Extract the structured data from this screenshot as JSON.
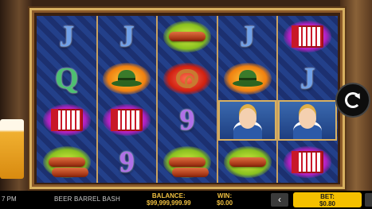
{
  "game": {
    "title": "BEER BARREL BASH"
  },
  "clock": {
    "time": "7 PM"
  },
  "reels": [
    [
      "J",
      "Q",
      "accordion",
      "sausages"
    ],
    [
      "J",
      "hat",
      "accordion",
      "9"
    ],
    [
      "sausage",
      "pretzel",
      "9",
      "sausages"
    ],
    [
      "J",
      "hat",
      "girl",
      "sausage"
    ],
    [
      "accordion",
      "J",
      "girl",
      "accordion"
    ]
  ],
  "bottom_bar": {
    "balance_label": "BALANCE:",
    "balance_value": "$99,999,999.99",
    "win_label": "WIN:",
    "win_value": "$0.00",
    "bet_label": "BET:",
    "bet_value": "$0.80",
    "bet_prev_symbol": "‹"
  },
  "colors": {
    "accent": "#f4c000",
    "frame": "#d8b060",
    "reel_bg": "#1c3070"
  },
  "icons": {
    "spin": "spin-icon"
  }
}
